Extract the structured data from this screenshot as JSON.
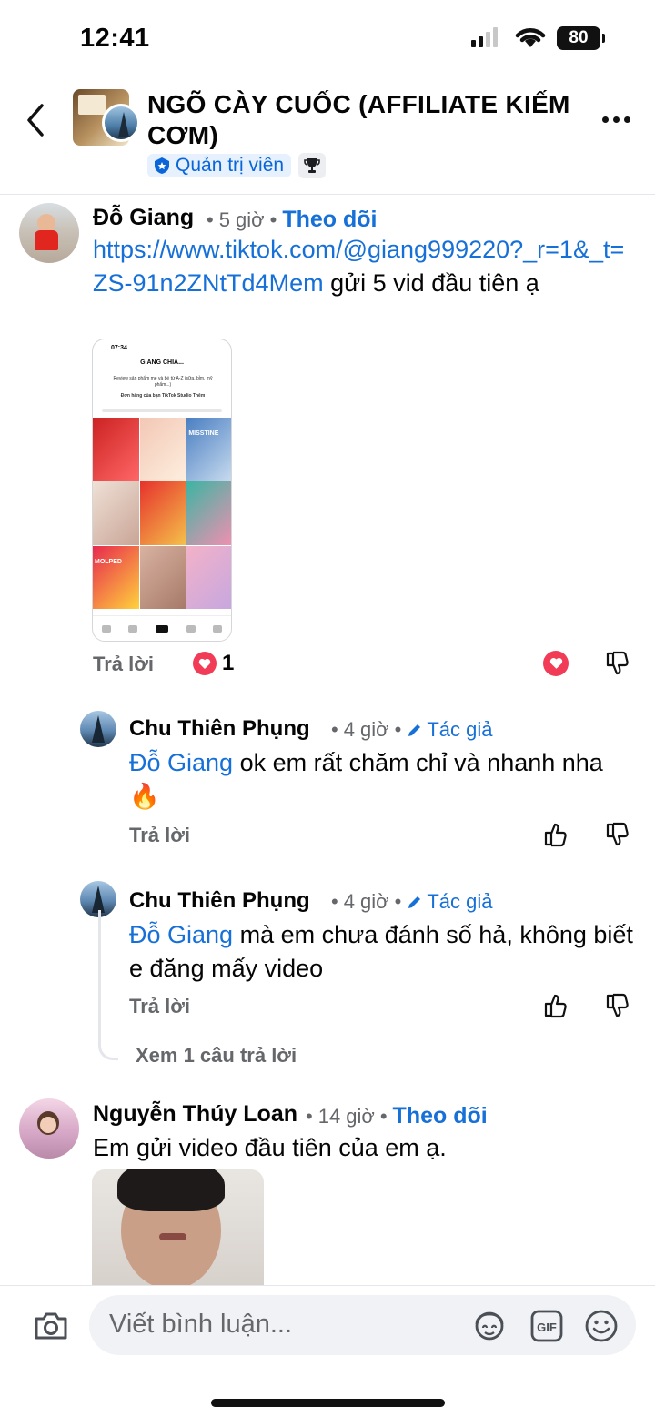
{
  "status_bar": {
    "time": "12:41",
    "battery": "80"
  },
  "header": {
    "title": "NGÕ CÀY CUỐC (AFFILIATE KIẾM CƠM)",
    "role": "Quản trị viên",
    "icons": [
      "back-arrow-icon",
      "more-icon",
      "trophy-icon",
      "shield-star-icon"
    ]
  },
  "comments": [
    {
      "author": "Đỗ Giang",
      "time": "5 giờ",
      "sep": "•",
      "follow": "Theo dõi",
      "link": "https://www.tiktok.com/@giang999220?_r=1&_t=ZS-91n2ZNtTd4Mem",
      "text": " gửi 5 vid đầu tiên ạ",
      "reply": "Trả lời",
      "reaction_count": "1",
      "attachment": {
        "clock": "07:34",
        "profile_title": "GIANG CHIA...",
        "bio": "Review sản phẩm mẹ và bé từ A-Z (sữa, bỉm, mỹ phẩm...)",
        "links": "Đơn hàng của bạn   TikTok Studio   Thêm",
        "tiles": [
          "MISSTINE",
          "MOLPED"
        ]
      }
    },
    {
      "author": "Chu Thiên Phụng",
      "time": "4 giờ",
      "sep": "•",
      "badge": "Tác giả",
      "mention": "Đỗ Giang",
      "text": " ok em rất chăm chỉ và nhanh nha 🔥",
      "reply": "Trả lời"
    },
    {
      "author": "Chu Thiên Phụng",
      "time": "4 giờ",
      "sep": "•",
      "badge": "Tác giả",
      "mention": "Đỗ Giang",
      "text": " mà em chưa đánh số hả, không biết e đăng mấy video",
      "reply": "Trả lời",
      "more_replies": "Xem 1 câu trả lời"
    },
    {
      "author": "Nguyễn Thúy Loan",
      "time": "14 giờ",
      "sep": "•",
      "follow": "Theo dõi",
      "text": "Em gửi video đầu tiên của em ạ."
    }
  ],
  "composer": {
    "placeholder": "Viết bình luận...",
    "icons": [
      "camera-icon",
      "avatar-sticker-icon",
      "gif-icon",
      "emoji-icon"
    ]
  },
  "colors": {
    "link": "#1670d8",
    "muted": "#65676b",
    "heart": "#f23c57",
    "input_bg": "#f0f2f5"
  }
}
